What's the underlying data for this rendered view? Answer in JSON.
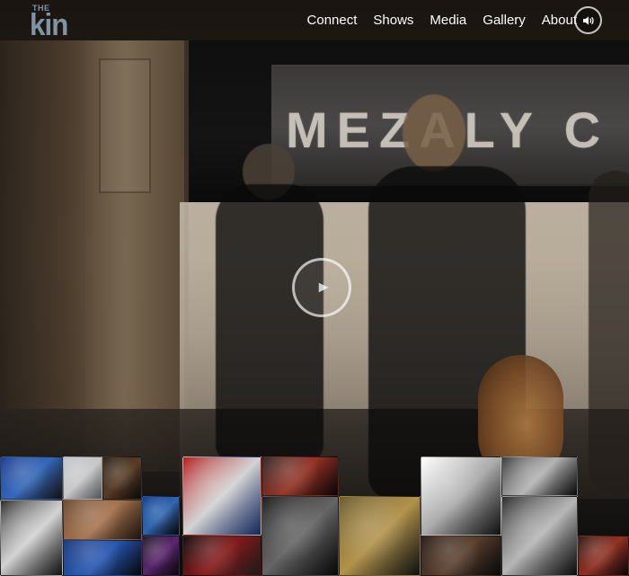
{
  "brand": {
    "logo_small": "THE",
    "logo_big": "kin"
  },
  "nav": {
    "items": [
      "Connect",
      "Shows",
      "Media",
      "Gallery",
      "About"
    ]
  },
  "controls": {
    "sound_icon": "speaker-icon",
    "play_icon": "play-icon"
  },
  "hero": {
    "marquee_text": "MEZALY C"
  },
  "colors": {
    "nav_text": "#ffffff",
    "logo": "#7f95a6"
  },
  "gallery": {
    "tiles": [
      {
        "name": "gallery-thumb-1",
        "bg": "linear-gradient(135deg,#1d3b8b,#3f7de0,#1a1a1a)"
      },
      {
        "name": "gallery-thumb-2",
        "bg": "linear-gradient(135deg,#bfc3c7,#f2f2f2,#7d8186)"
      },
      {
        "name": "gallery-thumb-3",
        "bg": "linear-gradient(135deg,#2a221a,#6b4a2e,#0d0d0d)"
      },
      {
        "name": "gallery-thumb-4",
        "bg": "linear-gradient(135deg,#2b2b2b,#ffffff,#1a1a1a)"
      },
      {
        "name": "gallery-thumb-5",
        "bg": "linear-gradient(135deg,#6a4b35,#c88a5d,#2b1d15)"
      },
      {
        "name": "gallery-thumb-6",
        "bg": "linear-gradient(135deg,#1e3a7a,#2b66d6,#0d0d0d)"
      },
      {
        "name": "gallery-thumb-7",
        "bg": "linear-gradient(135deg,#0b3a88,#3b7ad4,#0a0a0a)"
      },
      {
        "name": "gallery-thumb-8",
        "bg": "linear-gradient(135deg,#1a1a1a,#6d2d86,#0b0b0b)"
      },
      {
        "name": "gallery-thumb-9",
        "bg": "linear-gradient(135deg,#b11b1b,#ffffff,#1c3b8a)"
      },
      {
        "name": "gallery-thumb-10",
        "bg": "linear-gradient(135deg,#0f0f0f,#a01d1d,#2a2a2a)"
      },
      {
        "name": "gallery-thumb-11",
        "bg": "linear-gradient(135deg,#1c1c1c,#7a7a7a,#0c0c0c)"
      },
      {
        "name": "gallery-thumb-12",
        "bg": "linear-gradient(135deg,#6c5a2b,#d7b15a,#1a1a1a)"
      },
      {
        "name": "gallery-thumb-13",
        "bg": "linear-gradient(135deg,#ffffff,#cfcfcf,#1c1c1c)"
      },
      {
        "name": "gallery-thumb-14",
        "bg": "linear-gradient(135deg,#2a1e18,#6a4a34,#0e0e0e)"
      },
      {
        "name": "gallery-thumb-15",
        "bg": "linear-gradient(135deg,#2a2a2a,#dcdcdc,#111111)"
      },
      {
        "name": "gallery-thumb-16",
        "bg": "linear-gradient(135deg,#2b1a12,#b13b2a,#0c0c0c)"
      },
      {
        "name": "gallery-thumb-17",
        "bg": "linear-gradient(135deg,#3a3a3a,#d8d8d8,#0f0f0f)"
      },
      {
        "name": "gallery-thumb-18",
        "bg": "linear-gradient(135deg,#2a2a2a,#b23a2a,#0b0b0b)"
      }
    ]
  }
}
